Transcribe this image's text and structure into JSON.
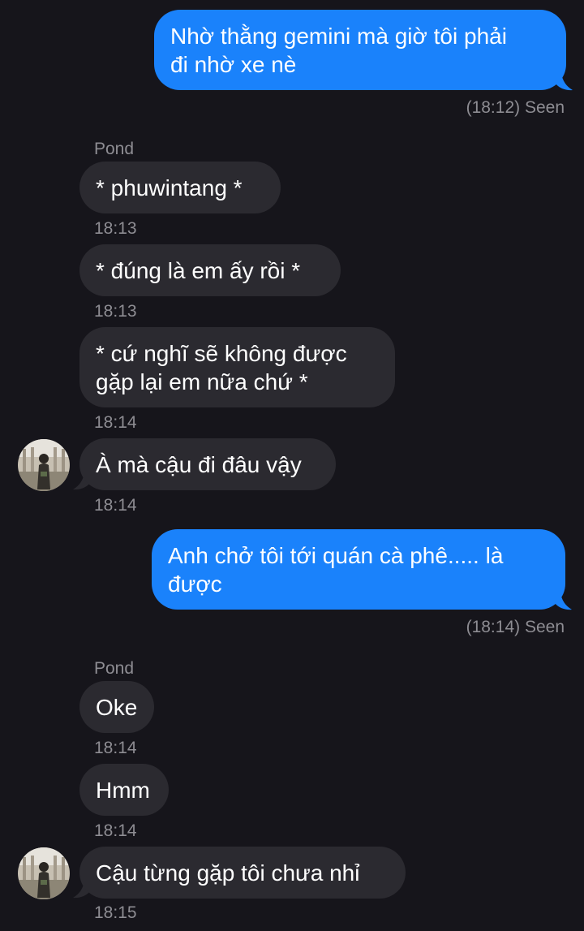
{
  "colors": {
    "background": "#16151b",
    "outgoing_bubble": "#1a82fb",
    "incoming_bubble": "#2b2a30",
    "meta_text": "#8e8d93"
  },
  "messages": [
    {
      "direction": "outgoing",
      "lines": [
        "Nhờ thằng gemini mà giờ tôi phải",
        "đi nhờ xe nè"
      ],
      "status": "(18:12) Seen"
    },
    {
      "direction": "incoming",
      "sender": "Pond",
      "text": "* phuwintang *",
      "time": "18:13"
    },
    {
      "direction": "incoming",
      "text": "* đúng là em ấy rồi *",
      "time": "18:13"
    },
    {
      "direction": "incoming",
      "lines": [
        "* cứ nghĩ sẽ không được",
        "gặp lại em nữa chứ *"
      ],
      "time": "18:14"
    },
    {
      "direction": "incoming",
      "text": "À mà cậu đi đâu vậy",
      "time": "18:14",
      "avatar_icon": "user-avatar"
    },
    {
      "direction": "outgoing",
      "lines": [
        "Anh chở tôi tới quán cà phê..... là",
        "được"
      ],
      "status": "(18:14) Seen"
    },
    {
      "direction": "incoming",
      "sender": "Pond",
      "text": "Oke",
      "time": "18:14"
    },
    {
      "direction": "incoming",
      "text": "Hmm",
      "time": "18:14"
    },
    {
      "direction": "incoming",
      "text": "Cậu từng gặp tôi chưa nhỉ",
      "time": "18:15",
      "avatar_icon": "user-avatar"
    }
  ]
}
